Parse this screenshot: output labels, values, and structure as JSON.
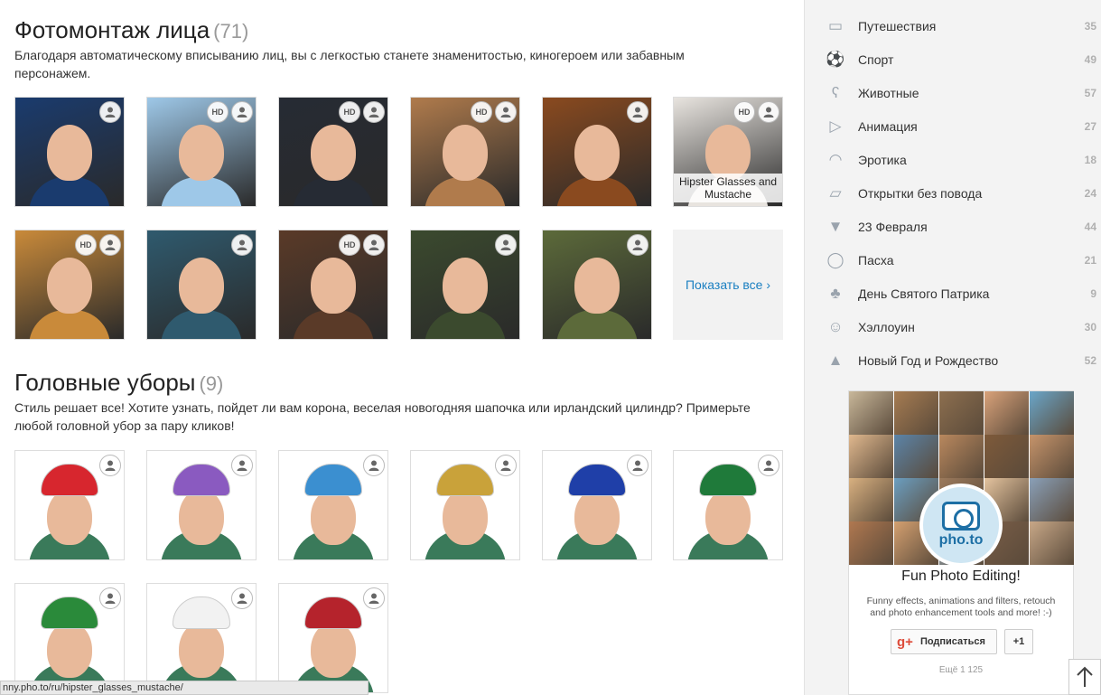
{
  "face_section": {
    "title": "Фотомонтаж лица",
    "count": "(71)",
    "description": "Благодаря автоматическому вписыванию лиц, вы с легкостью станете знаменитостью, киногероем или забавным персонажем.",
    "tiles": [
      {
        "hd": "",
        "caption": "",
        "bg": "#1a3b6e"
      },
      {
        "hd": "HD",
        "caption": "",
        "bg": "#9ec8e8"
      },
      {
        "hd": "HD",
        "caption": "",
        "bg": "#262b34"
      },
      {
        "hd": "HD",
        "caption": "",
        "bg": "#b07b4c"
      },
      {
        "hd": "",
        "caption": "",
        "bg": "#8a4a1f"
      },
      {
        "hd": "HD",
        "caption": "Hipster Glasses and Mustache",
        "bg": "#e8e4df"
      },
      {
        "hd": "HD",
        "caption": "",
        "bg": "#c98a3a"
      },
      {
        "hd": "",
        "caption": "",
        "bg": "#2f5a6e"
      },
      {
        "hd": "HD",
        "caption": "",
        "bg": "#5a3a28"
      },
      {
        "hd": "",
        "caption": "",
        "bg": "#3b4a2e"
      },
      {
        "hd": "",
        "caption": "",
        "bg": "#5c6a3a"
      }
    ],
    "show_all": "Показать все ›"
  },
  "hat_section": {
    "title": "Головные уборы",
    "count": "(9)",
    "description": "Стиль решает все! Хотите узнать, пойдет ли вам корона, веселая новогодняя шапочка или ирландский цилиндр? Примерьте любой головной убор за пару кликов!",
    "tiles": [
      {
        "hat_color": "#d7262e"
      },
      {
        "hat_color": "#8a5ac0"
      },
      {
        "hat_color": "#3b8fd0"
      },
      {
        "hat_color": "#c9a23a"
      },
      {
        "hat_color": "#1f3fa8"
      },
      {
        "hat_color": "#1f7a3a"
      },
      {
        "hat_color": "#2a8a3a"
      },
      {
        "hat_color": "#f2f2f2"
      },
      {
        "hat_color": "#b5232c"
      }
    ]
  },
  "sidebar": {
    "categories": [
      {
        "label": "Путешествия",
        "count": "35",
        "icon": "suitcase-icon",
        "glyph": "▭"
      },
      {
        "label": "Спорт",
        "count": "49",
        "icon": "soccer-ball-icon",
        "glyph": "⚽"
      },
      {
        "label": "Животные",
        "count": "57",
        "icon": "bear-face-icon",
        "glyph": "ʕ"
      },
      {
        "label": "Анимация",
        "count": "27",
        "icon": "video-camera-icon",
        "glyph": "▷"
      },
      {
        "label": "Эротика",
        "count": "18",
        "icon": "lips-icon",
        "glyph": "◠"
      },
      {
        "label": "Открытки без повода",
        "count": "24",
        "icon": "cards-icon",
        "glyph": "▱"
      },
      {
        "label": "23 Февраля",
        "count": "44",
        "icon": "tie-icon",
        "glyph": "▼"
      },
      {
        "label": "Пасха",
        "count": "21",
        "icon": "egg-icon",
        "glyph": "◯"
      },
      {
        "label": "День Святого Патрика",
        "count": "9",
        "icon": "clover-icon",
        "glyph": "♣"
      },
      {
        "label": "Хэллоуин",
        "count": "30",
        "icon": "pumpkin-icon",
        "glyph": "☺"
      },
      {
        "label": "Новый Год и Рождество",
        "count": "52",
        "icon": "santa-hat-icon",
        "glyph": "▲"
      }
    ]
  },
  "widget": {
    "brand": "pho.to",
    "title": "Fun Photo Editing!",
    "description": "Funny effects, animations and filters, retouch and photo enhancement tools and more! :-)",
    "subscribe_label": "Подписаться",
    "gplus_glyph": "g+",
    "plusone_label": "+1",
    "more": "Ещё 1 125",
    "mosaic_colors": [
      "#c8b79a",
      "#a67c52",
      "#8d6f4f",
      "#d9a27a",
      "#6aa6c9",
      "#e0b88e",
      "#5b84a8",
      "#b9885e",
      "#7e5a3a",
      "#c6946b",
      "#d8b080",
      "#6b9ec0",
      "#9c7a5c",
      "#e4c39e",
      "#8aa0b8",
      "#b07850",
      "#d4a070",
      "#a0b8c8",
      "#7a5e48",
      "#c8a888"
    ]
  },
  "status_bar": {
    "url": "nny.pho.to/ru/hipster_glasses_mustache/"
  }
}
